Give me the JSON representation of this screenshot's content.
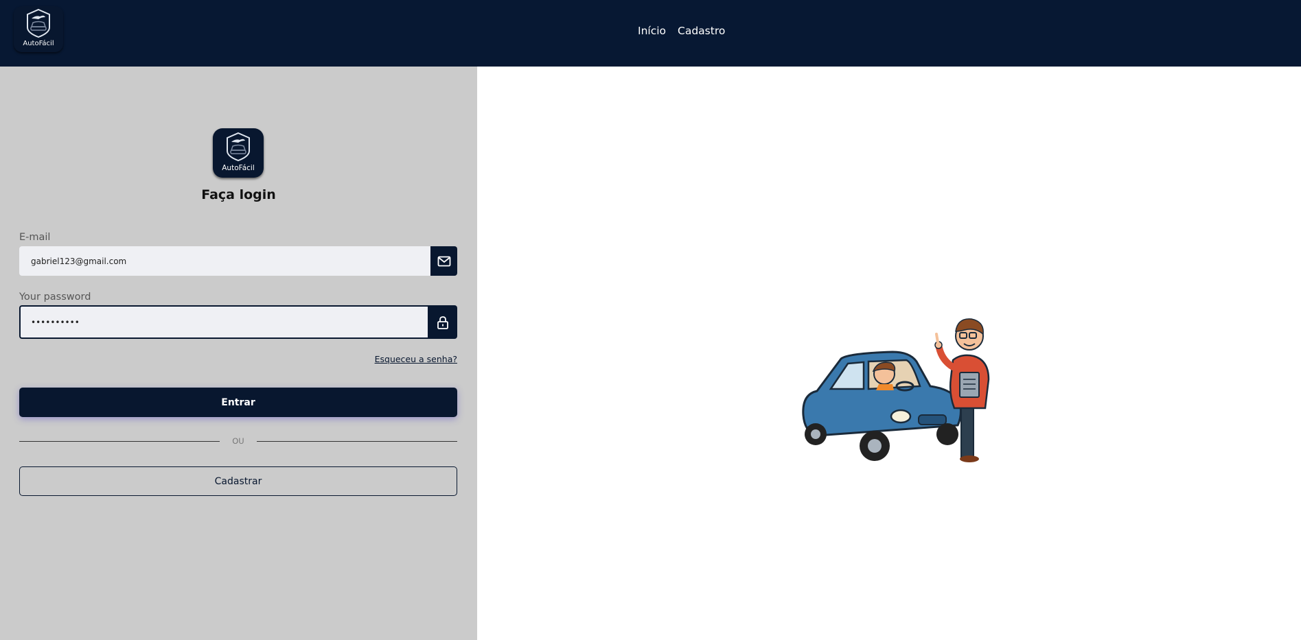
{
  "brand": {
    "name": "AutoFácil"
  },
  "nav": {
    "home": "Início",
    "register": "Cadastro"
  },
  "login": {
    "title": "Faça login",
    "email_label": "E-mail",
    "email_value": "gabriel123@gmail.com",
    "password_label": "Your password",
    "password_value": "••••••••••",
    "forgot": "Esqueceu a senha?",
    "submit": "Entrar",
    "divider": "OU",
    "register": "Cadastrar"
  },
  "icons": {
    "email": "mail-icon",
    "password": "lock-icon",
    "logo": "car-logo-icon",
    "illustration": "driving-instructor-illustration"
  },
  "colors": {
    "navy": "#071833",
    "left_panel": "#cbcbcb",
    "input_bg": "#eff0f4",
    "car_blue": "#3a79ad",
    "instructor_shirt": "#d94f34"
  }
}
